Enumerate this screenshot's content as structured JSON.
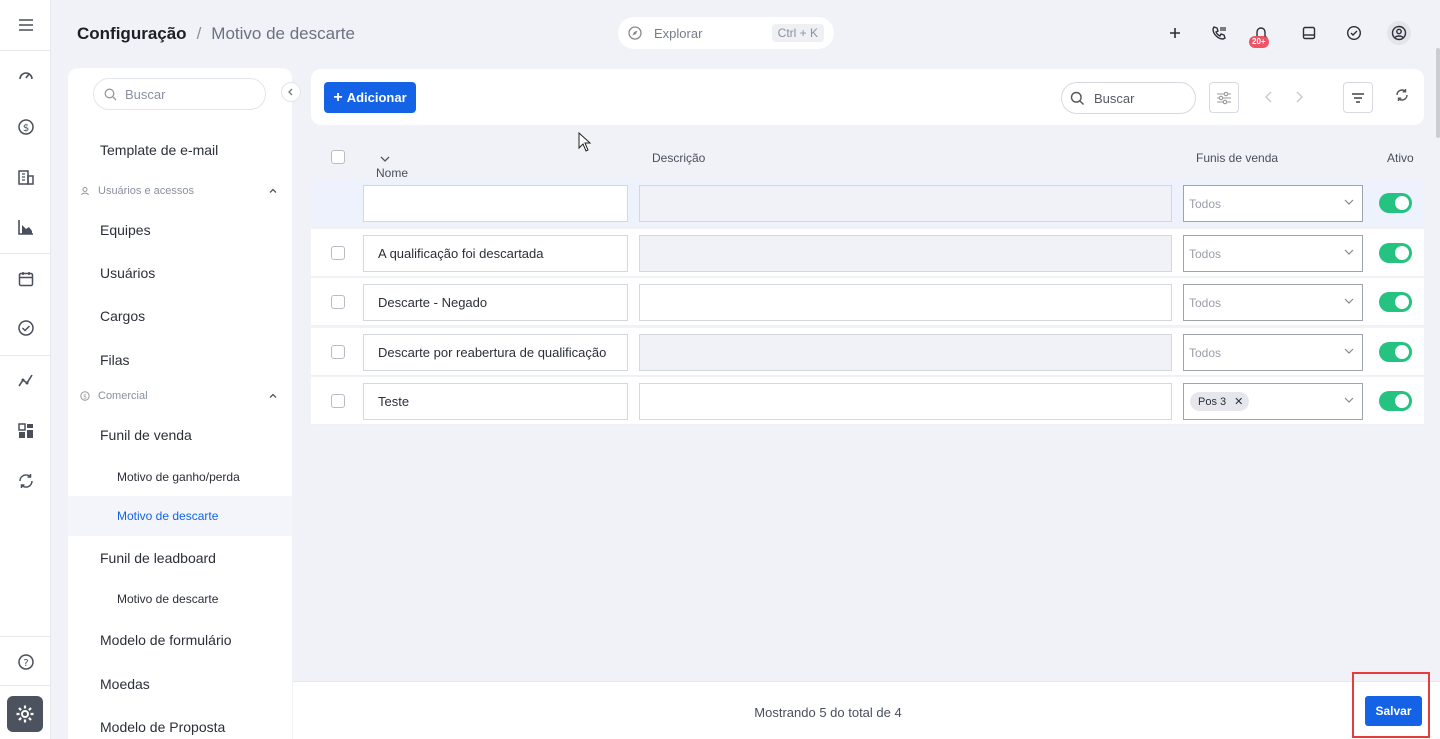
{
  "header": {
    "title": "Configuração",
    "separator": "/",
    "subtitle": "Motivo de descarte",
    "explore_label": "Explorar",
    "explore_shortcut": "Ctrl + K",
    "notification_badge": "20+"
  },
  "rail": {
    "icons": [
      "menu-icon",
      "dashboard-icon",
      "dollar-icon",
      "building-icon",
      "chart-icon",
      "calendar-icon",
      "check-circle-icon",
      "trend-icon",
      "apps-icon",
      "sync-icon",
      "help-icon",
      "settings-icon"
    ]
  },
  "sidebar": {
    "search_placeholder": "Buscar",
    "template_email": "Template de e-mail",
    "section_users": "Usuários e acessos",
    "equipes": "Equipes",
    "usuarios": "Usuários",
    "cargos": "Cargos",
    "filas": "Filas",
    "section_comercial": "Comercial",
    "funil_venda": "Funil de venda",
    "motivo_ganho": "Motivo de ganho/perda",
    "motivo_descarte": "Motivo de descarte",
    "funil_leadboard": "Funil de leadboard",
    "motivo_descarte_2": "Motivo de descarte",
    "modelo_formulario": "Modelo de formulário",
    "moedas": "Moedas",
    "modelo_proposta": "Modelo de Proposta"
  },
  "toolbar": {
    "add_label": "Adicionar",
    "search_placeholder": "Buscar"
  },
  "table": {
    "headers": {
      "name": "Nome",
      "description": "Descrição",
      "funnels": "Funis de venda",
      "active": "Ativo"
    },
    "new_row": {
      "name": "",
      "funnel": "Todos",
      "active": true
    },
    "rows": [
      {
        "name": "A qualificação foi descartada",
        "funnel": "Todos",
        "active": true
      },
      {
        "name": "Descarte - Negado",
        "funnel": "Todos",
        "active": true
      },
      {
        "name": "Descarte por reabertura de qualificação",
        "funnel": "Todos",
        "active": true
      },
      {
        "name": "Teste",
        "funnel_chip": "Pos 3",
        "active": true
      }
    ]
  },
  "footer": {
    "summary": "Mostrando 5 do total de 4",
    "save_label": "Salvar"
  },
  "colors": {
    "accent": "#1463e6",
    "toggle_on": "#26c281",
    "badge": "#f05366",
    "highlight": "#e83c3c"
  }
}
